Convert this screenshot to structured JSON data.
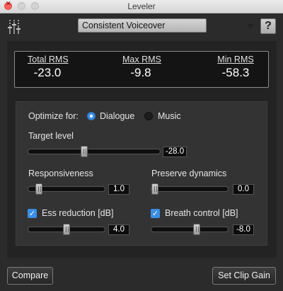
{
  "window": {
    "title": "Leveler"
  },
  "toolbar": {
    "preset": {
      "selected": "Consistent Voiceover"
    },
    "help_label": "?"
  },
  "meters": [
    {
      "label": "Total RMS",
      "value": "-23.0"
    },
    {
      "label": "Max RMS",
      "value": "-9.8"
    },
    {
      "label": "Min RMS",
      "value": "-58.3"
    }
  ],
  "optimize": {
    "label": "Optimize for:",
    "options": [
      {
        "label": "Dialogue",
        "selected": true
      },
      {
        "label": "Music",
        "selected": false
      }
    ]
  },
  "controls": {
    "target_level": {
      "label": "Target level",
      "value": "-28.0",
      "level": 0.42
    },
    "responsiveness": {
      "label": "Responsiveness",
      "value": "1.0",
      "level": 0.1
    },
    "preserve_dynamics": {
      "label": "Preserve dynamics",
      "value": "0.0",
      "level": 0.0
    },
    "ess_reduction": {
      "label": "Ess reduction [dB]",
      "value": "4.0",
      "level": 0.5,
      "checked": true
    },
    "breath_control": {
      "label": "Breath control [dB]",
      "value": "-8.0",
      "level": 0.6,
      "checked": true
    }
  },
  "footer": {
    "compare_label": "Compare",
    "set_clip_gain_label": "Set Clip Gain"
  },
  "colors": {
    "accent": "#3a8ee6",
    "background": "#2b2b2b",
    "panel": "#333333"
  },
  "icons": [
    "close-icon",
    "leveler-module-icon",
    "dropdown-caret-icon",
    "menu-lines-icon",
    "help-icon",
    "checkmark-icon"
  ]
}
